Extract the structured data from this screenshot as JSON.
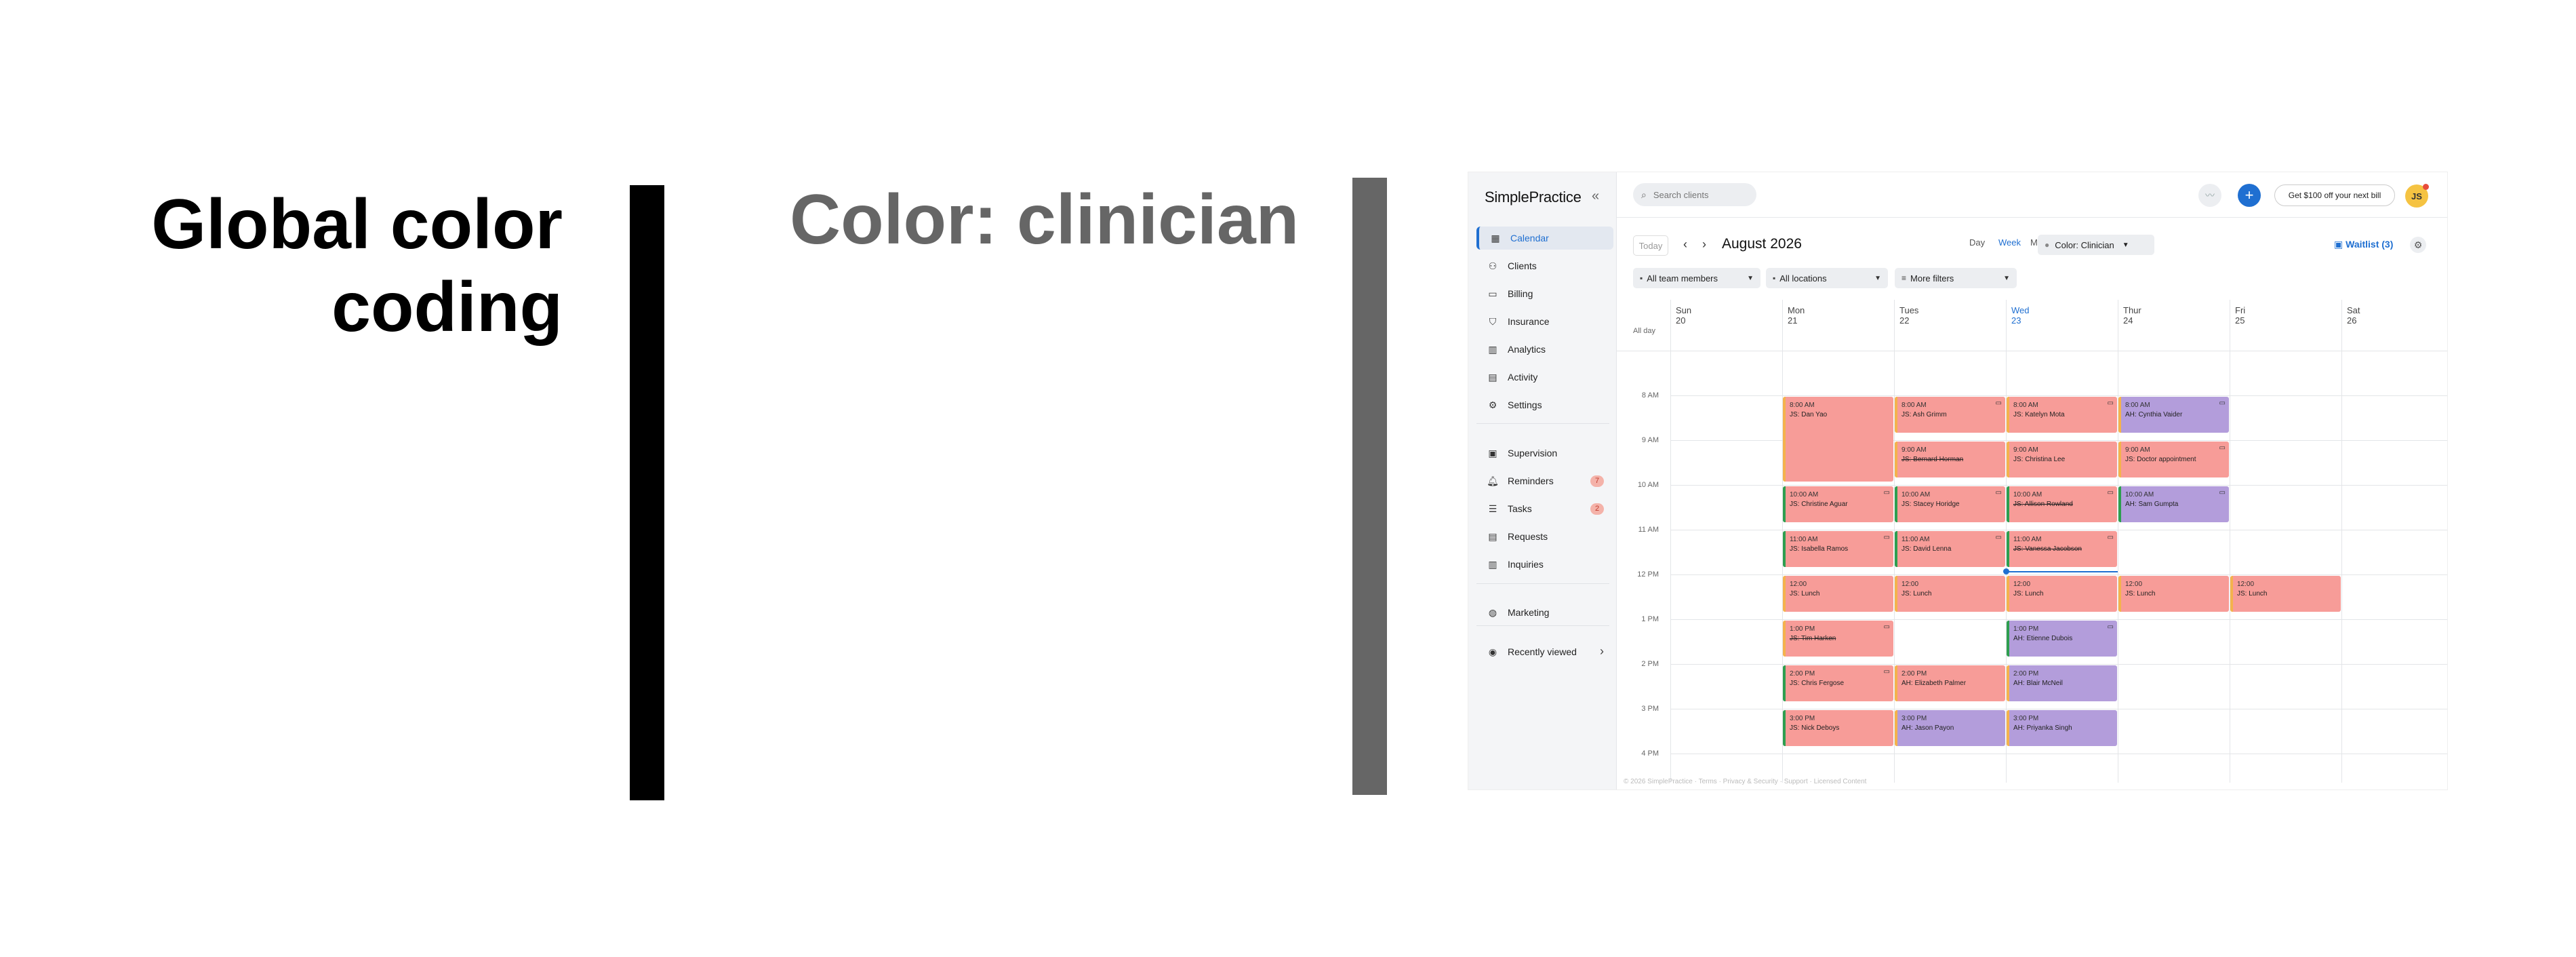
{
  "slide": {
    "left_title": "Global color\ncoding",
    "mid_title": "Color: clinician"
  },
  "app": {
    "logo": "SimplePractice",
    "search_placeholder": "Search clients",
    "promo_label": "Get $100 off your next bill",
    "avatar_initials": "JS",
    "colors": {
      "accent": "#1f6fd1",
      "event_clinician_js": "#f79c98",
      "event_clinician_ah": "#b39ddb"
    }
  },
  "sidebar": {
    "items": [
      {
        "label": "Calendar",
        "icon": "calendar-icon"
      },
      {
        "label": "Clients",
        "icon": "clients-icon"
      },
      {
        "label": "Billing",
        "icon": "billing-icon"
      },
      {
        "label": "Insurance",
        "icon": "shield-icon"
      },
      {
        "label": "Analytics",
        "icon": "analytics-icon"
      },
      {
        "label": "Activity",
        "icon": "activity-icon"
      },
      {
        "label": "Settings",
        "icon": "gear-icon"
      },
      {
        "label": "Supervision",
        "icon": "supervision-icon"
      },
      {
        "label": "Reminders",
        "icon": "bell-icon",
        "badge": "7"
      },
      {
        "label": "Tasks",
        "icon": "tasks-icon",
        "badge": "2"
      },
      {
        "label": "Requests",
        "icon": "requests-icon"
      },
      {
        "label": "Inquiries",
        "icon": "inquiries-icon"
      },
      {
        "label": "Marketing",
        "icon": "globe-icon"
      },
      {
        "label": "Recently viewed",
        "icon": "eye-icon"
      }
    ]
  },
  "toolbar": {
    "today": "Today",
    "month": "August 2026",
    "views": [
      "Day",
      "Week",
      "Month"
    ],
    "active_view": "Week",
    "color_label": "Color:",
    "color_value": "Clinician",
    "waitlist": "Waitlist (3)",
    "filters": [
      "All team members",
      "All locations",
      "More filters"
    ]
  },
  "calendar": {
    "days": [
      "Sun 20",
      "Mon 21",
      "Tues 22",
      "Wed 23",
      "Thur 24",
      "Fri 25",
      "Sat 26"
    ],
    "today_index": 3,
    "all_day": "All day",
    "times": [
      "8 AM",
      "9 AM",
      "10 AM",
      "11 AM",
      "12 PM",
      "1 PM",
      "2 PM",
      "3 PM",
      "4 PM"
    ],
    "events": [
      {
        "day": 1,
        "start": 8,
        "dur": 1.9,
        "time": "8:00 AM",
        "name": "JS: Dan Yao",
        "color": "pink",
        "stripe": "orange"
      },
      {
        "day": 2,
        "start": 8,
        "dur": 0.8,
        "time": "8:00 AM",
        "name": "JS: Ash Grimm",
        "color": "pink",
        "stripe": "orange",
        "video": true
      },
      {
        "day": 3,
        "start": 8,
        "dur": 0.8,
        "time": "8:00 AM",
        "name": "JS: Katelyn Mota",
        "color": "pink",
        "stripe": "orange",
        "video": true
      },
      {
        "day": 4,
        "start": 8,
        "dur": 0.8,
        "time": "8:00 AM",
        "name": "AH: Cynthia Vaider",
        "color": "purple",
        "stripe": "orange",
        "video": true
      },
      {
        "day": 2,
        "start": 9,
        "dur": 0.8,
        "time": "9:00 AM",
        "name": "JS: Bernard Horman",
        "color": "pink",
        "stripe": "orange",
        "strike": true
      },
      {
        "day": 3,
        "start": 9,
        "dur": 0.8,
        "time": "9:00 AM",
        "name": "JS: Christina Lee",
        "color": "pink",
        "stripe": "orange"
      },
      {
        "day": 4,
        "start": 9,
        "dur": 0.8,
        "time": "9:00 AM",
        "name": "JS: Doctor appointment",
        "color": "pink",
        "stripe": "orange",
        "video": true
      },
      {
        "day": 1,
        "start": 10,
        "dur": 0.8,
        "time": "10:00 AM",
        "name": "JS: Christine Aguar",
        "color": "pink",
        "stripe": "green",
        "video": true
      },
      {
        "day": 2,
        "start": 10,
        "dur": 0.8,
        "time": "10:00 AM",
        "name": "JS: Stacey Horidge",
        "color": "pink",
        "stripe": "green",
        "video": true
      },
      {
        "day": 3,
        "start": 10,
        "dur": 0.8,
        "time": "10:00 AM",
        "name": "JS: Allison Rowland",
        "color": "pink",
        "stripe": "green",
        "strike": true,
        "video": true
      },
      {
        "day": 4,
        "start": 10,
        "dur": 0.8,
        "time": "10:00 AM",
        "name": "AH: Sam Gumpta",
        "color": "purple",
        "stripe": "green",
        "video": true
      },
      {
        "day": 1,
        "start": 11,
        "dur": 0.8,
        "time": "11:00 AM",
        "name": "JS: Isabella Ramos",
        "color": "pink",
        "stripe": "green",
        "video": true
      },
      {
        "day": 2,
        "start": 11,
        "dur": 0.8,
        "time": "11:00 AM",
        "name": "JS: David Lenna",
        "color": "pink",
        "stripe": "green",
        "video": true
      },
      {
        "day": 3,
        "start": 11,
        "dur": 0.8,
        "time": "11:00 AM",
        "name": "JS: Vanessa Jacobson",
        "color": "pink",
        "stripe": "green",
        "strike": true,
        "video": true
      },
      {
        "day": 1,
        "start": 12,
        "dur": 0.8,
        "time": "12:00",
        "name": "JS: Lunch",
        "color": "pink",
        "stripe": "orange"
      },
      {
        "day": 2,
        "start": 12,
        "dur": 0.8,
        "time": "12:00",
        "name": "JS: Lunch",
        "color": "pink",
        "stripe": "orange"
      },
      {
        "day": 3,
        "start": 12,
        "dur": 0.8,
        "time": "12:00",
        "name": "JS: Lunch",
        "color": "pink",
        "stripe": "orange"
      },
      {
        "day": 4,
        "start": 12,
        "dur": 0.8,
        "time": "12:00",
        "name": "JS: Lunch",
        "color": "pink",
        "stripe": "orange"
      },
      {
        "day": 5,
        "start": 12,
        "dur": 0.8,
        "time": "12:00",
        "name": "JS: Lunch",
        "color": "pink",
        "stripe": "orange"
      },
      {
        "day": 1,
        "start": 13,
        "dur": 0.8,
        "time": "1:00 PM",
        "name": "JS: Tim Harken",
        "color": "pink",
        "stripe": "orange",
        "strike": true,
        "video": true
      },
      {
        "day": 3,
        "start": 13,
        "dur": 0.8,
        "time": "1:00 PM",
        "name": "AH: Etienne Dubois",
        "color": "purple",
        "stripe": "green",
        "video": true
      },
      {
        "day": 1,
        "start": 14,
        "dur": 0.8,
        "time": "2:00 PM",
        "name": "JS: Chris Fergose",
        "color": "pink",
        "stripe": "green",
        "video": true
      },
      {
        "day": 2,
        "start": 14,
        "dur": 0.8,
        "time": "2:00 PM",
        "name": "AH: Elizabeth Palmer",
        "color": "pink",
        "stripe": "orange"
      },
      {
        "day": 3,
        "start": 14,
        "dur": 0.8,
        "time": "2:00 PM",
        "name": "AH: Blair McNeil",
        "color": "purple",
        "stripe": "orange"
      },
      {
        "day": 1,
        "start": 15,
        "dur": 0.8,
        "time": "3:00 PM",
        "name": "JS: Nick Deboys",
        "color": "pink",
        "stripe": "green"
      },
      {
        "day": 2,
        "start": 15,
        "dur": 0.8,
        "time": "3:00 PM",
        "name": "AH: Jason Payon",
        "color": "purple",
        "stripe": "orange"
      },
      {
        "day": 3,
        "start": 15,
        "dur": 0.8,
        "time": "3:00 PM",
        "name": "AH: Priyanka Singh",
        "color": "purple",
        "stripe": "orange"
      }
    ]
  },
  "footer": "© 2026 SimplePractice · Terms · Privacy & Security · Support · Licensed Content",
  "help_label": "?"
}
